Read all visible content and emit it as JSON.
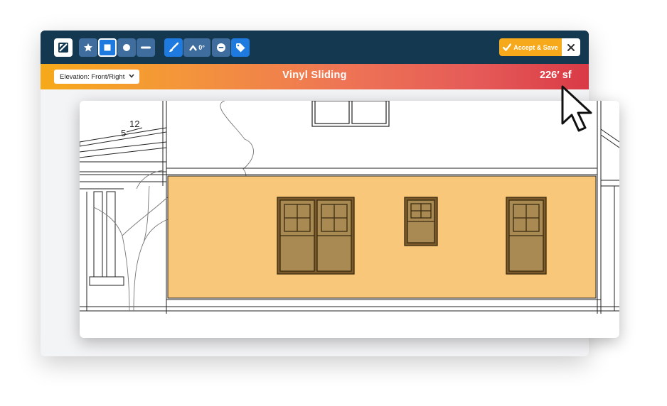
{
  "toolbar": {
    "angle_label": "0°",
    "accept_label": "Accept & Save",
    "close_label": "×"
  },
  "infobar": {
    "elevation_select": "Elevation: Front/Right",
    "material_title": "Vinyl Sliding",
    "area_value": "226′ sf"
  },
  "drawing": {
    "pitch_rise": "5",
    "pitch_run": "12"
  },
  "colors": {
    "toolbar_bg": "#13384f",
    "tool_blue": "#1f7ae0",
    "accent_orange": "#f6a91a",
    "gradient_end": "#d93a46",
    "siding_fill": "#f9c77a",
    "window_fill": "#a98a53"
  },
  "icons": [
    "drawing-toggle-icon",
    "star-icon",
    "square-icon",
    "circle-icon",
    "line-icon",
    "paintbrush-icon",
    "roof-angle-icon",
    "minus-circle-icon",
    "tag-icon",
    "check-icon",
    "close-icon",
    "chevron-down-icon",
    "cursor-arrow-icon"
  ]
}
